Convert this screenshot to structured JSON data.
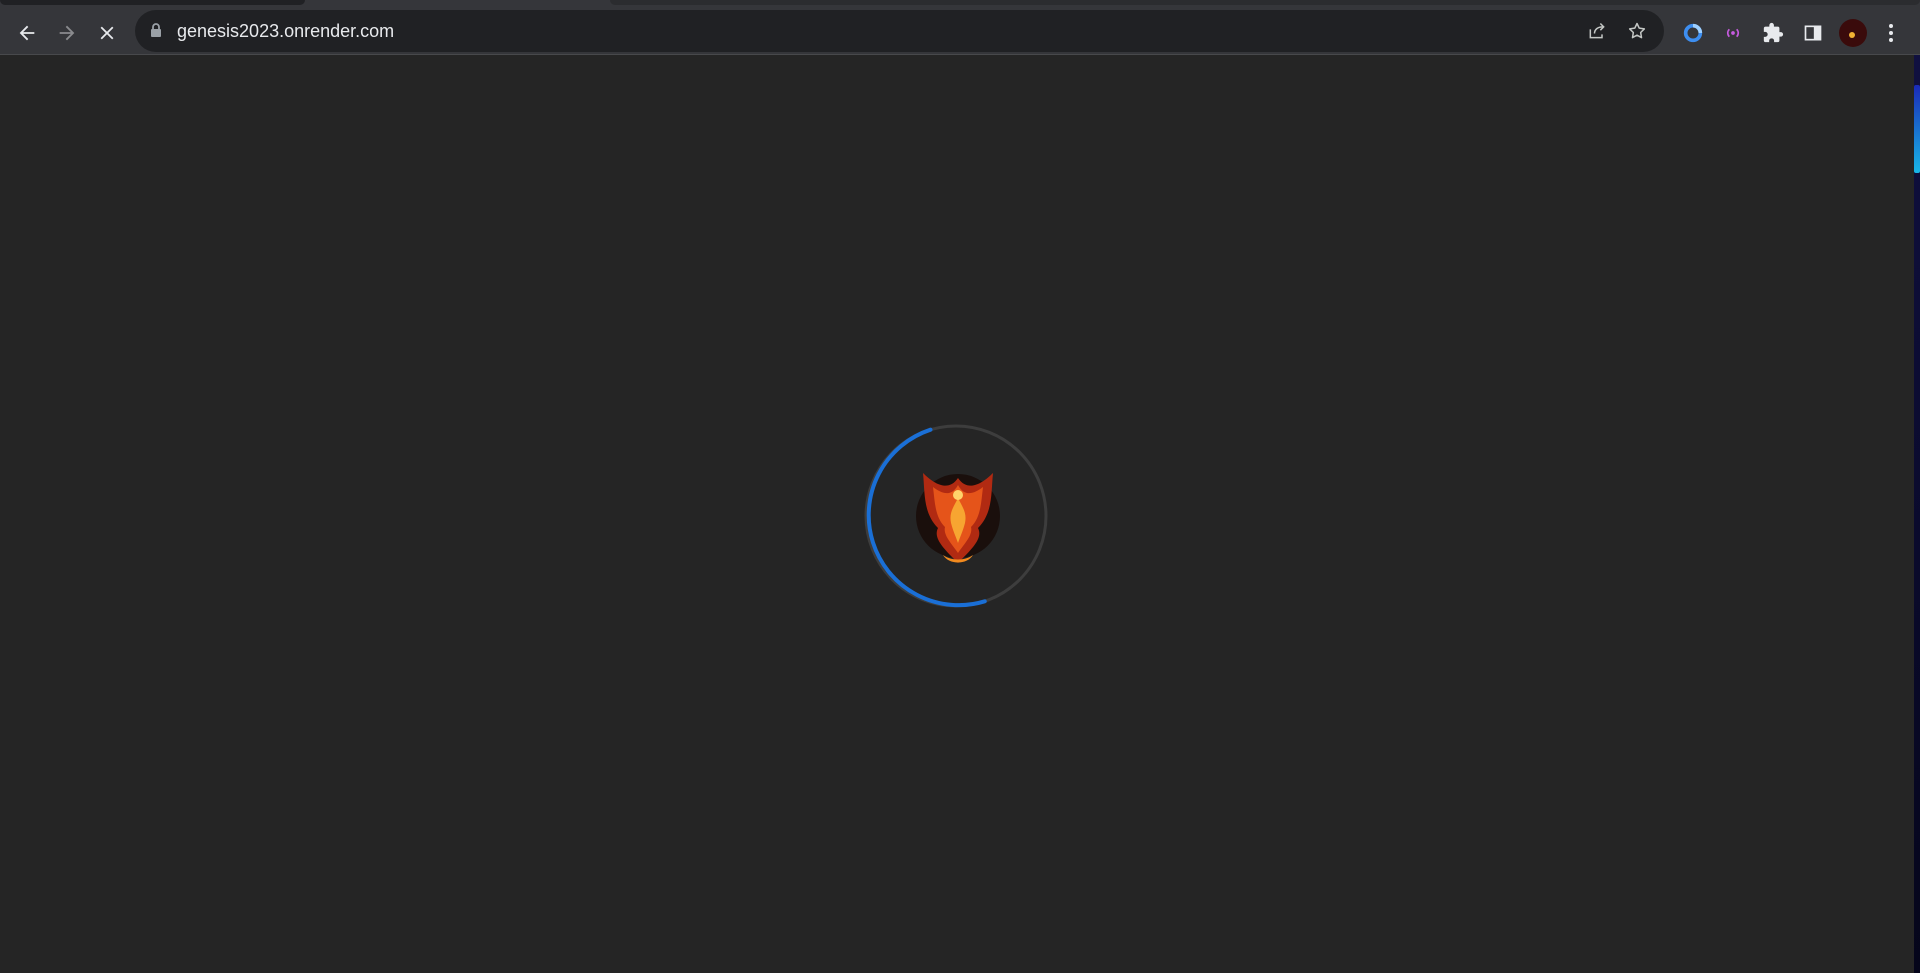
{
  "browser": {
    "address_bar": {
      "url": "genesis2023.onrender.com"
    },
    "toolbar": {
      "back_icon": "arrow-left-icon",
      "forward_icon": "arrow-right-icon",
      "stop_icon": "close-x-icon",
      "share_icon": "share-icon",
      "bookmark_icon": "star-icon",
      "extensions": [
        "blue-ring-extension-icon",
        "purple-signal-extension-icon",
        "puzzle-icon"
      ],
      "side_panel_icon": "side-panel-icon",
      "profile_icon": "avatar",
      "menu_icon": "kebab-menu-icon"
    },
    "colors": {
      "toolbar_bg": "#35363a",
      "omnibox_bg": "#202124",
      "page_bg": "#252525",
      "spinner_accent": "#1a6fd6"
    }
  },
  "page": {
    "state": "loading",
    "loader": {
      "logo": "phoenix-logo",
      "ring_color": "#1a6fd6"
    }
  }
}
